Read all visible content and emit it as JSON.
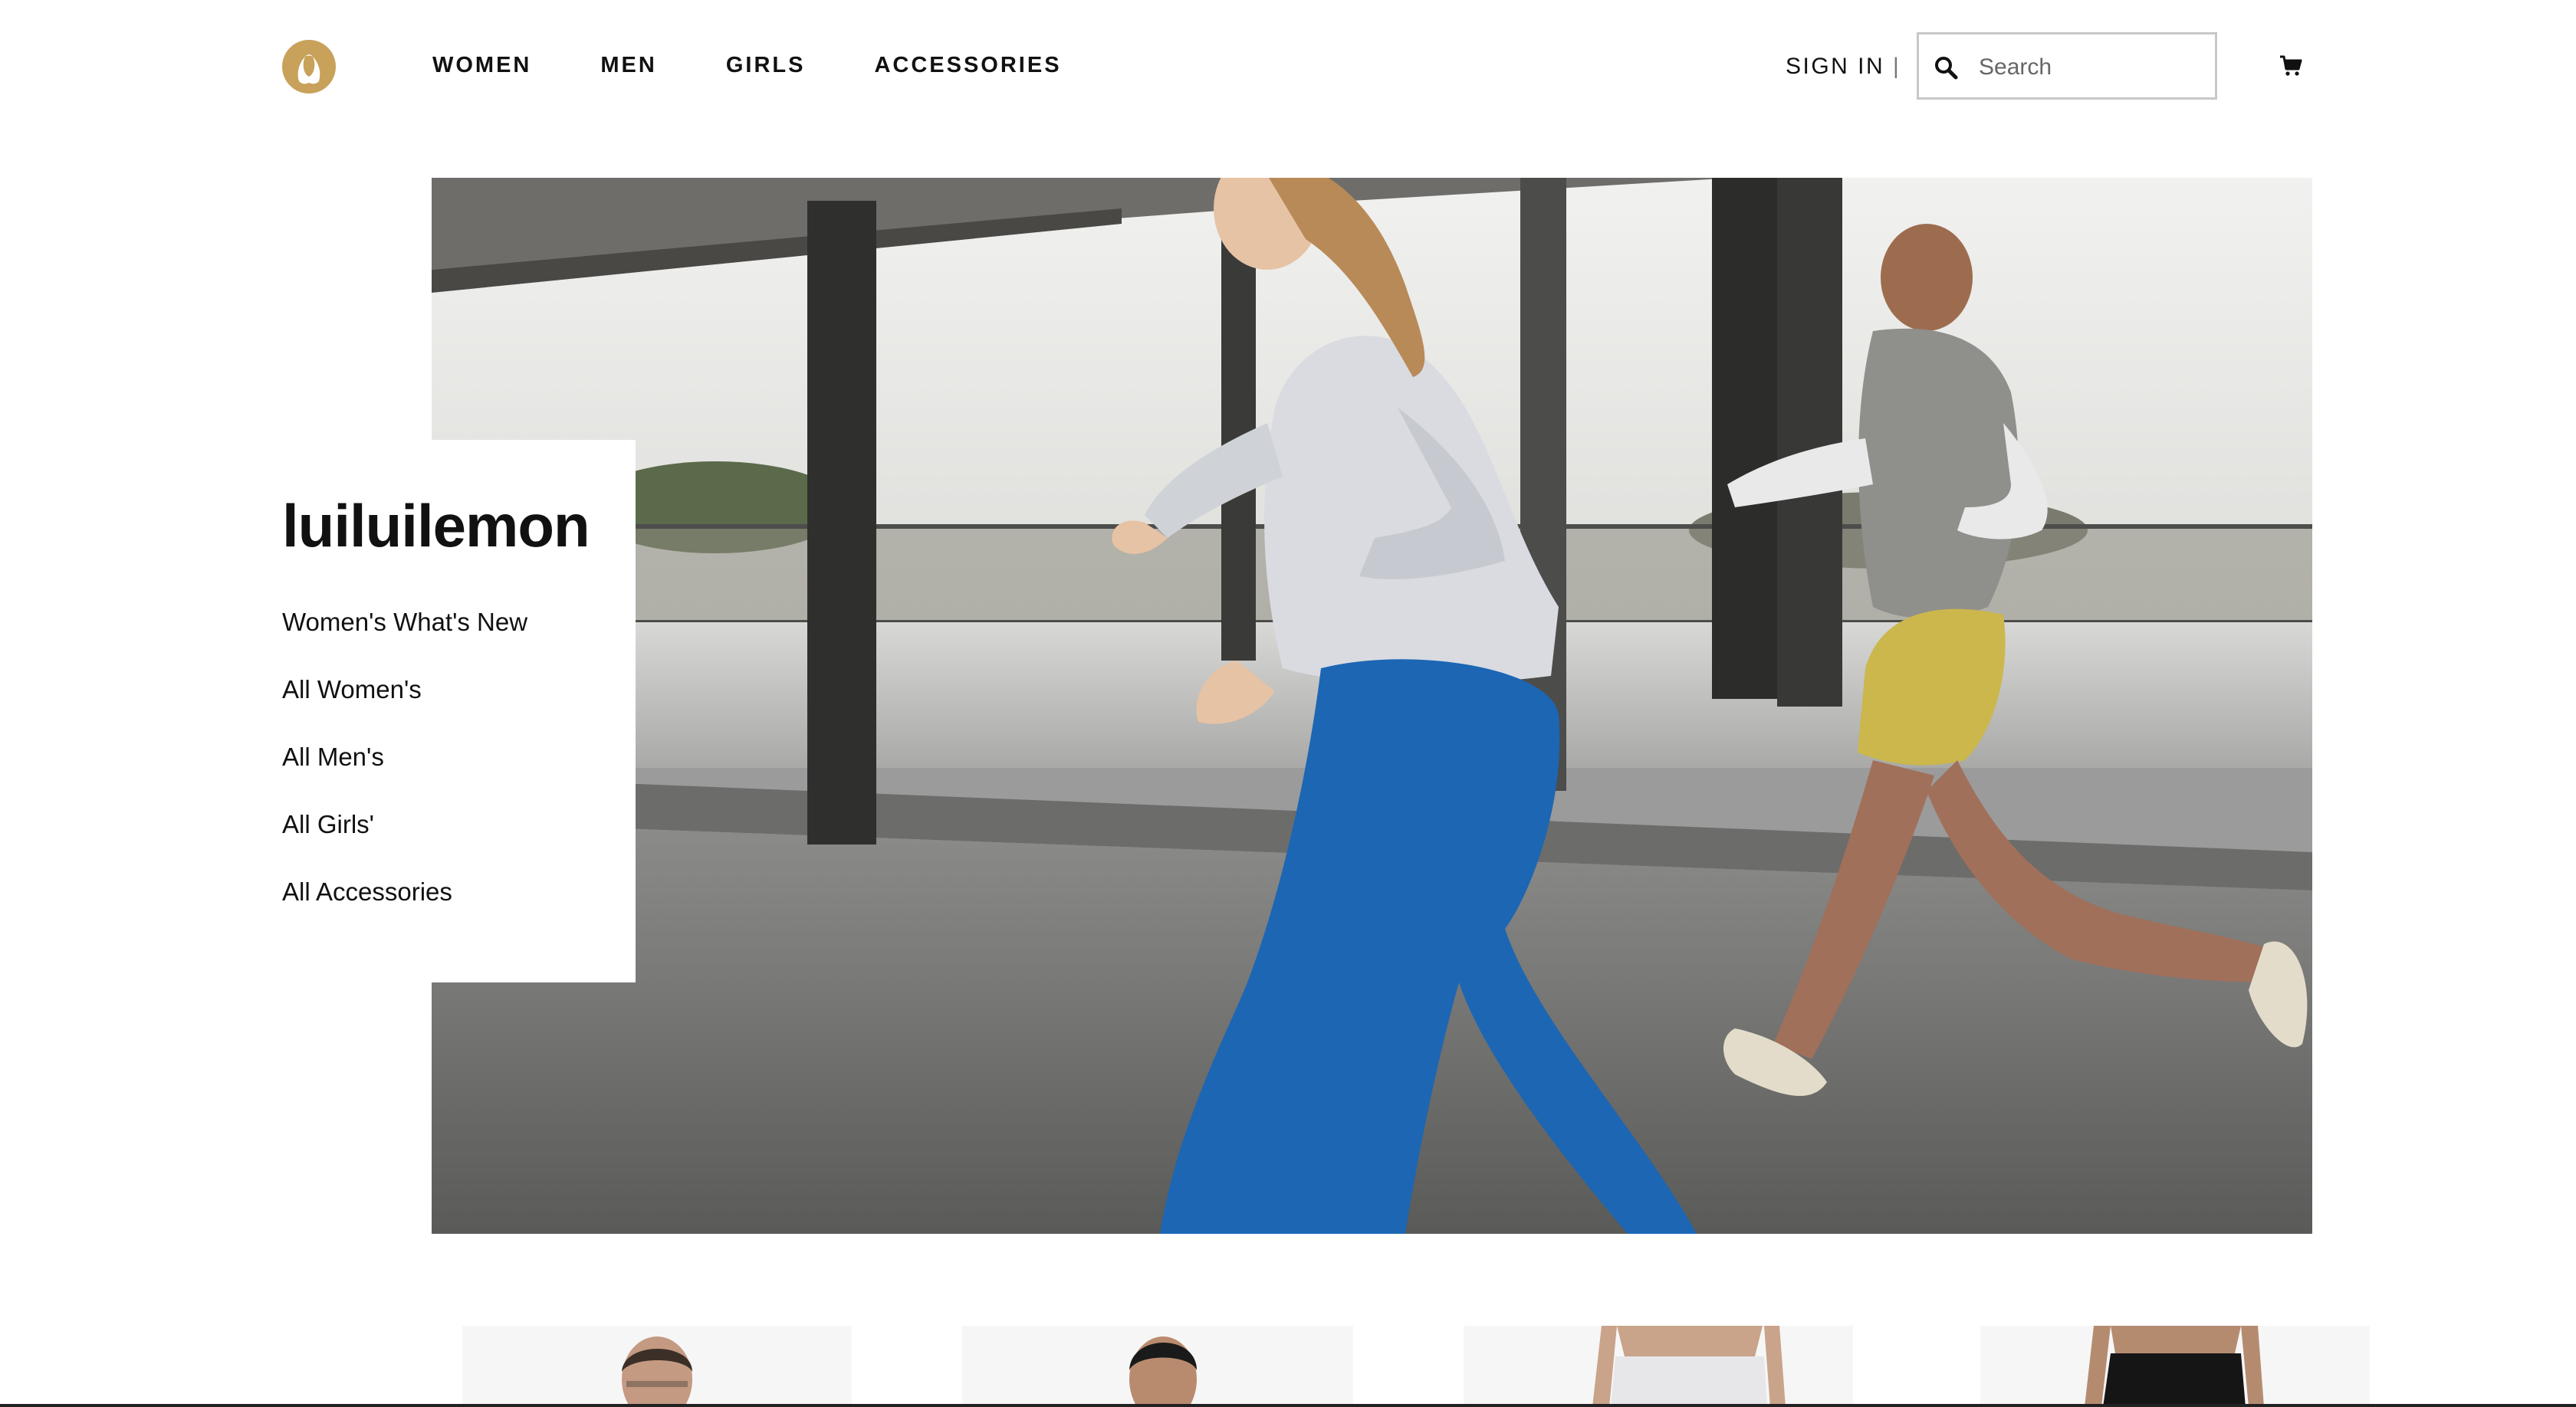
{
  "header": {
    "logo_name": "lululemon-logo",
    "nav": [
      {
        "label": "WOMEN"
      },
      {
        "label": "MEN"
      },
      {
        "label": "GIRLS"
      },
      {
        "label": "ACCESSORIES"
      }
    ],
    "sign_in": "SIGN IN",
    "separator": "|",
    "search": {
      "placeholder": "Search",
      "value": ""
    },
    "cart_icon": "cart-icon"
  },
  "hero": {
    "image": "two women running on a wet road under an overpass"
  },
  "side_panel": {
    "title": "luiluilemon",
    "links": [
      {
        "label": "Women's What's New"
      },
      {
        "label": "All Women's"
      },
      {
        "label": "All Men's"
      },
      {
        "label": "All Girls'"
      },
      {
        "label": "All Accessories"
      }
    ]
  },
  "products": [
    {
      "image": "man portrait"
    },
    {
      "image": "man portrait"
    },
    {
      "image": "grey shorts"
    },
    {
      "image": "black shorts"
    }
  ],
  "colors": {
    "accent_gold": "#c8a15a",
    "text": "#111111",
    "search_border": "#c8c8c8"
  }
}
